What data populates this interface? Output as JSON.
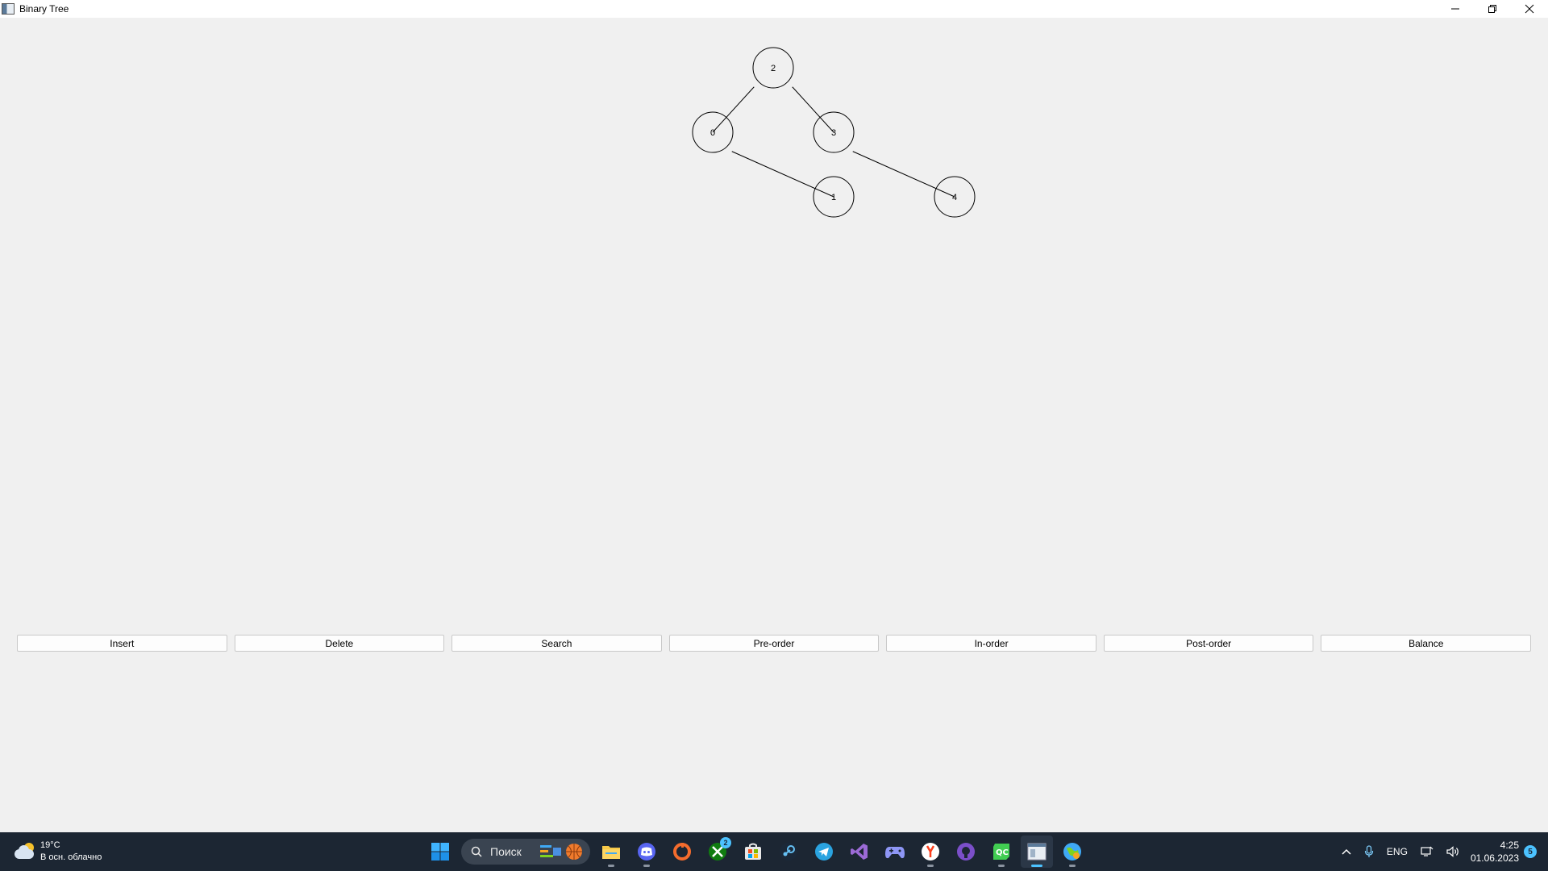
{
  "window": {
    "title": "Binary Tree"
  },
  "tree": {
    "nodes": [
      {
        "id": "n2",
        "value": "2"
      },
      {
        "id": "n0",
        "value": "0"
      },
      {
        "id": "n3",
        "value": "3"
      },
      {
        "id": "n1",
        "value": "1"
      },
      {
        "id": "n4",
        "value": "4"
      }
    ],
    "edges": [
      {
        "from": "n2",
        "to": "n0"
      },
      {
        "from": "n2",
        "to": "n3"
      },
      {
        "from": "n0",
        "to": "n1"
      },
      {
        "from": "n3",
        "to": "n4"
      }
    ]
  },
  "buttons": {
    "insert": "Insert",
    "delete": "Delete",
    "search": "Search",
    "preorder": "Pre-order",
    "inorder": "In-order",
    "postorder": "Post-order",
    "balance": "Balance"
  },
  "taskbar": {
    "weather_temp": "19°C",
    "weather_desc": "В осн. облачно",
    "search_placeholder": "Поиск",
    "xbox_badge": "2",
    "lang": "ENG",
    "time": "4:25",
    "date": "01.06.2023",
    "notifications": "5"
  }
}
